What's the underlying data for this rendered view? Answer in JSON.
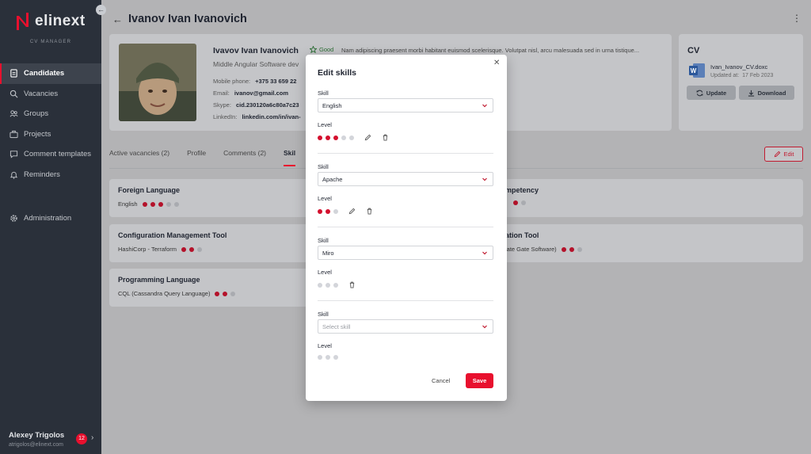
{
  "brand": {
    "name": "elinext",
    "subtitle": "CV MANAGER",
    "accent": "#e8102e"
  },
  "sidebar": {
    "items": [
      {
        "label": "Candidates",
        "icon": "document-icon",
        "active": true
      },
      {
        "label": "Vacancies",
        "icon": "search-icon"
      },
      {
        "label": "Groups",
        "icon": "users-icon"
      },
      {
        "label": "Projects",
        "icon": "briefcase-icon"
      },
      {
        "label": "Comment templates",
        "icon": "comment-icon"
      },
      {
        "label": "Reminders",
        "icon": "bell-icon"
      },
      {
        "label": "Administration",
        "icon": "gear-icon"
      }
    ],
    "user": {
      "name": "Alexey Trigolos",
      "email": "atrigolos@elinext.com",
      "badge": "12"
    }
  },
  "header": {
    "title": "Ivanov Ivan Ivanovich"
  },
  "profile": {
    "name": "Ivavov Ivan Ivanovich",
    "status": "Good",
    "description": "Nam adipiscing praesent morbi habitant euismod scelerisque. Volutpat nisl, arcu malesuada sed in urna tistique...",
    "role": "Middle Angular Software dev",
    "mobile_label": "Mobile phone:",
    "mobile": "+375 33 659 22",
    "email_label": "Email:",
    "email": "ivanov@gmail.com",
    "skype_label": "Skype:",
    "skype": "cid.230120a6c80a7c23",
    "linkedin_label": "LinkedIn:",
    "linkedin": "linkedin.com/in/ivan-"
  },
  "cv": {
    "title": "CV",
    "file": "Ivan_Ivanov_CV.doxc",
    "updated_label": "Updated at:",
    "updated": "17 Feb 2023",
    "update_btn": "Update",
    "download_btn": "Download"
  },
  "tabs": [
    {
      "label": "Active vacancies (2)"
    },
    {
      "label": "Profile"
    },
    {
      "label": "Comments (2)"
    },
    {
      "label": "Skil",
      "active": true
    }
  ],
  "edit_label": "Edit",
  "skill_cards": [
    {
      "title": "Foreign Language",
      "value": "English",
      "level": 3
    },
    {
      "title": "Configuration Management Tool",
      "value": "HashiCorp - Terraform",
      "level": 2
    },
    {
      "title": "Programming Language",
      "value": "CQL (Cassandra Query Language)",
      "level": 2
    },
    {
      "title": "mpetency",
      "value": "",
      "level": 1
    },
    {
      "title": "ation Tool",
      "value": "late Gate Software)",
      "level": 2
    }
  ],
  "modal": {
    "title": "Edit skills",
    "skill_label": "Skill",
    "level_label": "Level",
    "skills": [
      {
        "value": "English",
        "level": 3,
        "max": 5,
        "editable": true
      },
      {
        "value": "Apache",
        "level": 2,
        "max": 3,
        "editable": true
      },
      {
        "value": "Miro",
        "level": 0,
        "max": 3,
        "editable": false
      },
      {
        "value": "",
        "placeholder": "Select skill",
        "level": 0,
        "max": 3
      }
    ],
    "cancel": "Cancel",
    "save": "Save"
  }
}
